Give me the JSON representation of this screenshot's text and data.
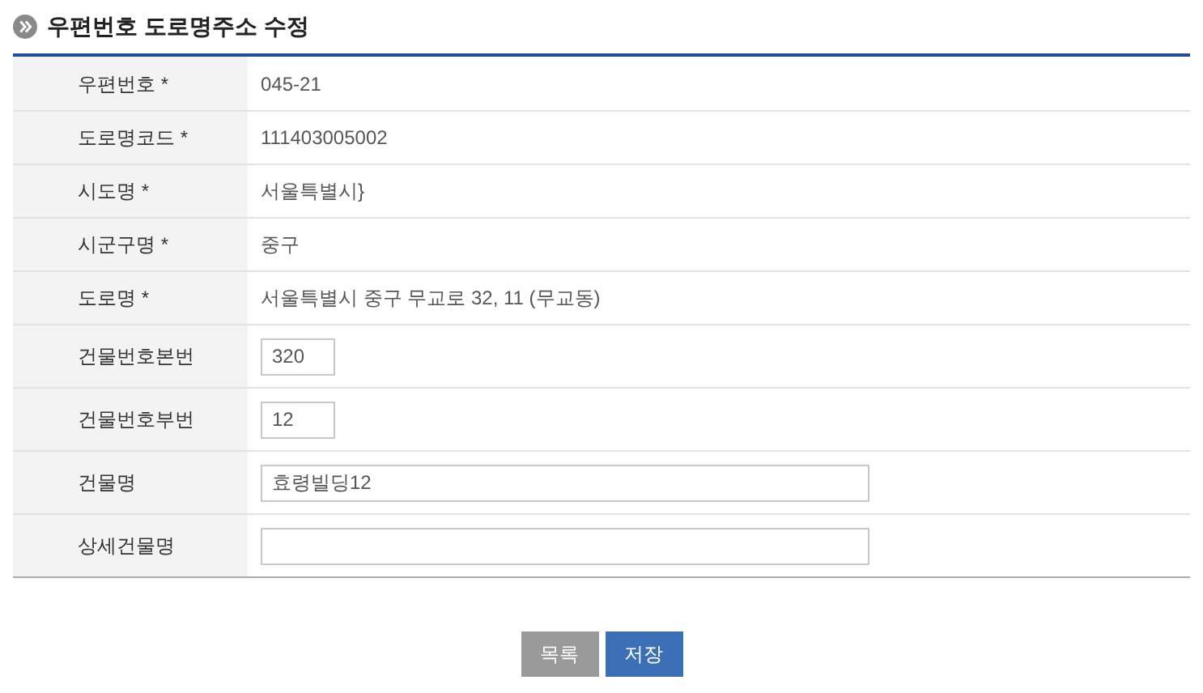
{
  "title": "우편번호 도로명주소 수정",
  "rows": [
    {
      "label": "우편번호 *",
      "kind": "text",
      "value": "045-21"
    },
    {
      "label": "도로명코드 *",
      "kind": "text",
      "value": "111403005002"
    },
    {
      "label": "시도명 *",
      "kind": "text",
      "value": "서울특별시}"
    },
    {
      "label": "시군구명 *",
      "kind": "text",
      "value": "중구"
    },
    {
      "label": "도로명 *",
      "kind": "text",
      "value": "서울특별시 중구 무교로 32, 11 (무교동)"
    },
    {
      "label": "건물번호본번",
      "kind": "short_input",
      "value": "320"
    },
    {
      "label": "건물번호부번",
      "kind": "short_input",
      "value": "12"
    },
    {
      "label": "건물명",
      "kind": "long_input",
      "value": "효령빌딩12"
    },
    {
      "label": "상세건물명",
      "kind": "long_input",
      "value": ""
    }
  ],
  "buttons": [
    {
      "label": "목록",
      "kind": "secondary"
    },
    {
      "label": "저장",
      "kind": "primary"
    }
  ]
}
